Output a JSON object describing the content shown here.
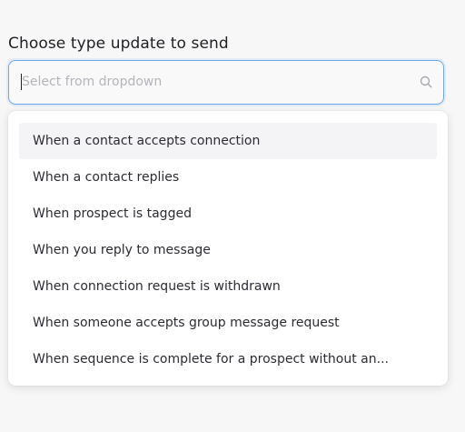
{
  "form": {
    "label": "Choose type update to send",
    "search_placeholder": "Select from dropdown",
    "search_value": ""
  },
  "dropdown": {
    "options": [
      "When a contact accepts connection",
      "When a contact replies",
      "When prospect is tagged",
      "When you reply to message",
      "When connection request is withdrawn",
      "When someone accepts group message request",
      "When sequence is complete for a prospect without an..."
    ],
    "highlighted_index": 0
  },
  "colors": {
    "focus_border": "#6fa8ea",
    "highlight_bg": "#f4f4f6",
    "text": "#2b2b33",
    "placeholder": "#b4b4ba"
  },
  "icons": {
    "search": "search-icon"
  }
}
